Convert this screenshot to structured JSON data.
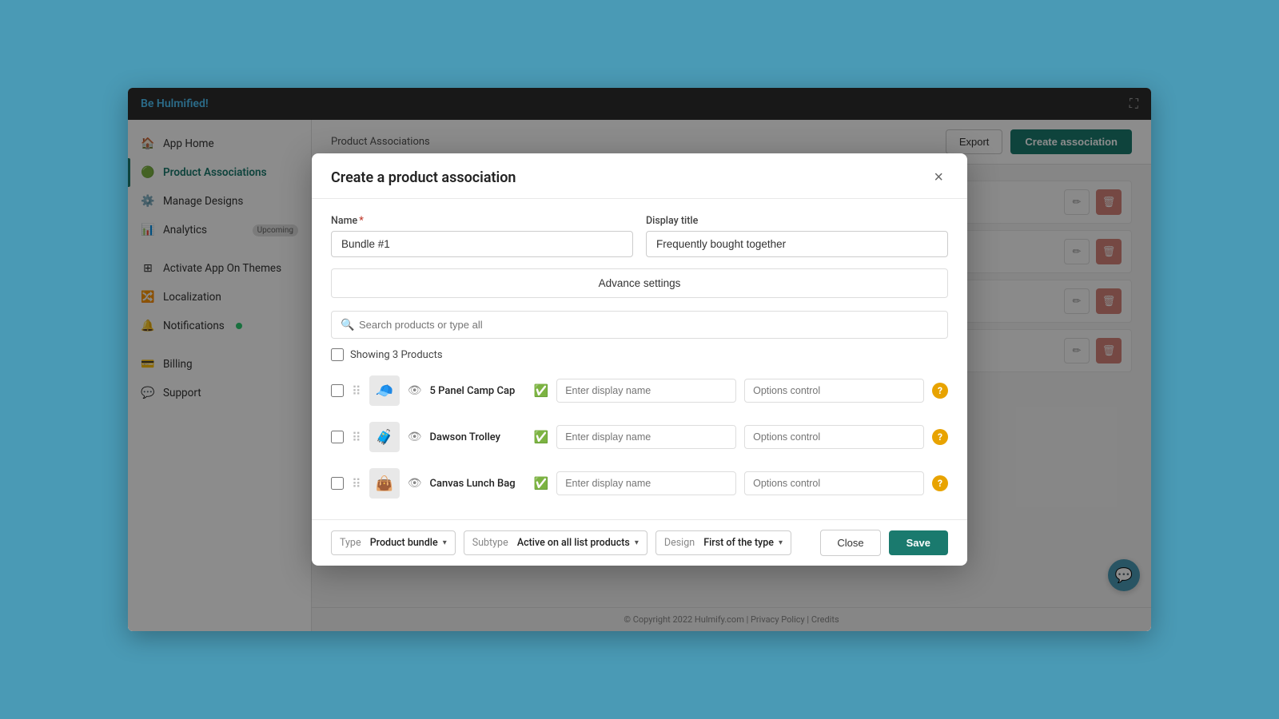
{
  "app": {
    "title_be": "Be",
    "title_brand": "Hulmified!",
    "fullscreen_icon": "⛶"
  },
  "sidebar": {
    "items": [
      {
        "id": "app-home",
        "label": "App Home",
        "icon": "🏠",
        "active": false
      },
      {
        "id": "product-associations",
        "label": "Product Associations",
        "icon": "🟢",
        "active": true
      },
      {
        "id": "manage-designs",
        "label": "Manage Designs",
        "icon": "⚙",
        "active": false
      },
      {
        "id": "analytics",
        "label": "Analytics",
        "icon": "📊",
        "active": false,
        "badge": "Upcoming"
      },
      {
        "id": "activate-app",
        "label": "Activate App On Themes",
        "icon": "⊞",
        "active": false
      },
      {
        "id": "localization",
        "label": "Localization",
        "icon": "🔀",
        "active": false
      },
      {
        "id": "notifications",
        "label": "Notifications",
        "icon": "🔔",
        "active": false,
        "dot": true
      },
      {
        "id": "billing",
        "label": "Billing",
        "icon": "💳",
        "active": false
      },
      {
        "id": "support",
        "label": "Support",
        "icon": "💬",
        "active": false
      }
    ]
  },
  "header": {
    "breadcrumb": "Product Associations",
    "export_label": "Export",
    "create_label": "Create association"
  },
  "table": {
    "rows": [
      {
        "id": 1
      },
      {
        "id": 2
      },
      {
        "id": 3
      },
      {
        "id": 4
      }
    ]
  },
  "modal": {
    "title": "Create a product association",
    "close_icon": "×",
    "name_label": "Name",
    "name_required": true,
    "name_value": "Bundle #1",
    "display_title_label": "Display title",
    "display_title_value": "Frequently bought together",
    "advance_settings_label": "Advance settings",
    "search_placeholder": "Search products or type all",
    "showing_label": "Showing 3 Products",
    "products": [
      {
        "id": 1,
        "name": "5 Panel Camp Cap",
        "thumb": "🧢",
        "verified": true,
        "display_name_placeholder": "Enter display name",
        "options_placeholder": "Options control"
      },
      {
        "id": 2,
        "name": "Dawson Trolley",
        "thumb": "🧳",
        "verified": true,
        "display_name_placeholder": "Enter display name",
        "options_placeholder": "Options control"
      },
      {
        "id": 3,
        "name": "Canvas Lunch Bag",
        "thumb": "👜",
        "verified": true,
        "display_name_placeholder": "Enter display name",
        "options_placeholder": "Options control"
      }
    ],
    "footer": {
      "type_prefix": "Type",
      "type_value": "Product bundle",
      "subtype_prefix": "Subtype",
      "subtype_value": "Active on all list products",
      "design_prefix": "Design",
      "design_value": "First of the type",
      "close_label": "Close",
      "save_label": "Save"
    }
  },
  "footer": {
    "copyright": "© Copyright 2022 Hulmify.com | Privacy Policy | Credits"
  }
}
